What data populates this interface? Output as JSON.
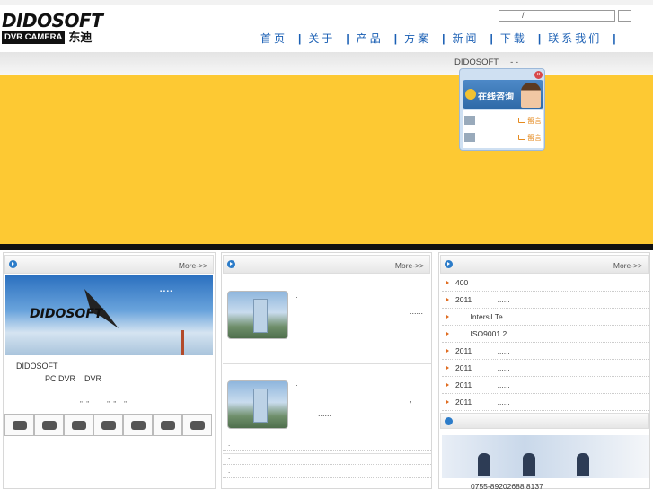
{
  "header": {
    "logo_brand": "DIDOSOFT",
    "logo_box": "DVR CAMERA",
    "logo_cn": "东迪",
    "search_placeholder": "/",
    "nav": [
      "首页",
      "关于",
      "产品",
      "方案",
      "新闻",
      "下载",
      "联系我们"
    ]
  },
  "banner": {
    "text": "DIDOSOFT     - -",
    "background": "#fdc933"
  },
  "chat": {
    "title": "在线咨询",
    "rows": [
      {
        "msg": "留言"
      },
      {
        "msg": "留言"
      }
    ]
  },
  "columns": {
    "col1": {
      "more": "More->>",
      "text1": "DIDOSOFT",
      "text2": "PC DVR    DVR",
      "text3": "\"  \"         \"  \"    \"",
      "thumbs": 7
    },
    "col2": {
      "more": "More->>",
      "items": [
        {
          "dot": ".",
          "more": "......"
        },
        {
          "dot": ".",
          "comma": ",",
          "more": "......"
        }
      ],
      "lines": [
        ".",
        ".",
        "."
      ]
    },
    "col3": {
      "more": "More->>",
      "news": [
        "400",
        "2011            ......",
        "       Intersil Te......",
        "       ISO9001 2......",
        "2011            ......",
        "2011            ......",
        "2011            ......",
        "2011            ......"
      ],
      "tel": "0755-89202688 8137"
    }
  }
}
